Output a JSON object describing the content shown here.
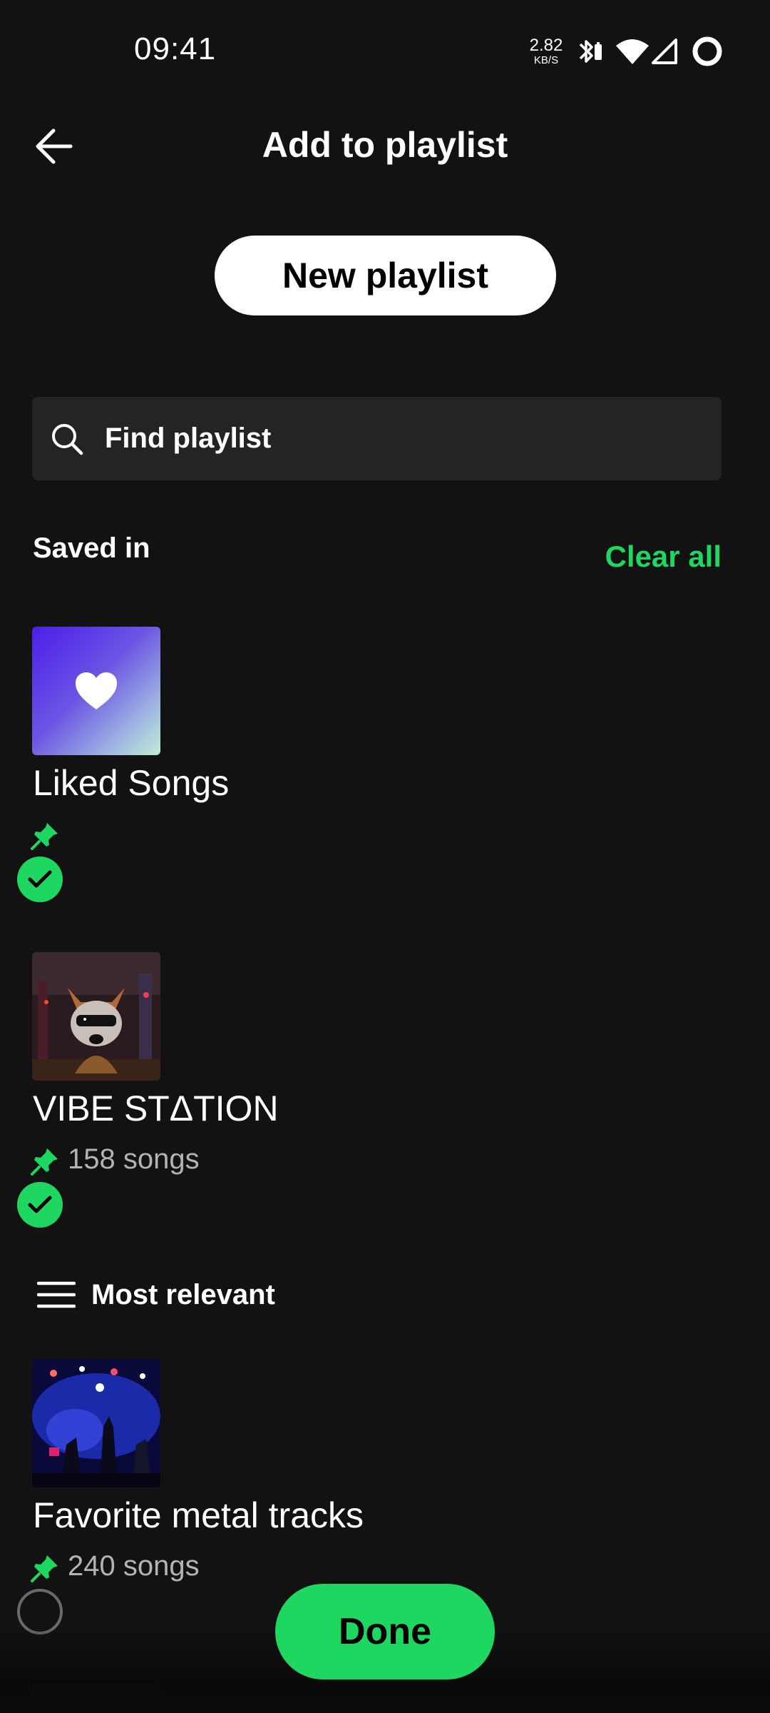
{
  "status_bar": {
    "time": "09:41",
    "net_speed_value": "2.82",
    "net_speed_unit": "KB/S",
    "icons": [
      "bluetooth-icon",
      "wifi-icon",
      "signal-icon",
      "battery-ring-icon"
    ]
  },
  "header": {
    "title": "Add to playlist",
    "back_icon": "arrow-left-icon"
  },
  "new_playlist": {
    "label": "New playlist"
  },
  "search": {
    "placeholder": "Find playlist",
    "value": ""
  },
  "saved_in": {
    "label": "Saved in",
    "clear_all_label": "Clear all",
    "items": [
      {
        "name": "Liked Songs",
        "song_count": "",
        "pinned": true,
        "selected": true
      },
      {
        "name": "VIBE STΔTION",
        "song_count": "158 songs",
        "pinned": true,
        "selected": true
      }
    ]
  },
  "sort": {
    "label": "Most relevant",
    "icon": "sort-lines-icon"
  },
  "playlists": [
    {
      "name": "Favorite metal tracks",
      "song_count": "240 songs",
      "pinned": true,
      "selected": false
    }
  ],
  "done": {
    "label": "Done"
  },
  "colors": {
    "accent": "#1ed760",
    "background": "#121212",
    "search_bg": "#242424",
    "secondary_text": "#b3b3b3"
  }
}
